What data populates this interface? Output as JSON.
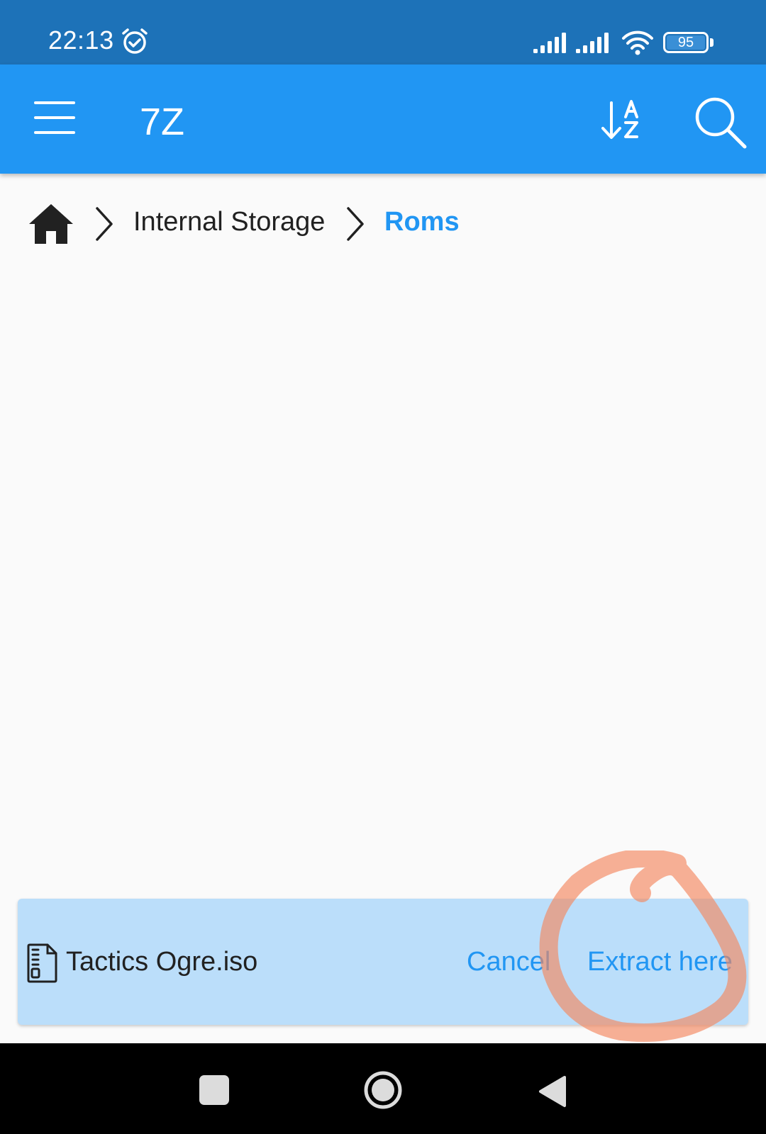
{
  "status_bar": {
    "time": "22:13",
    "battery": "95"
  },
  "app_bar": {
    "title": "7Z"
  },
  "breadcrumb": {
    "items": [
      "Internal Storage",
      "Roms"
    ]
  },
  "action_panel": {
    "file_name": "Tactics Ogre.iso",
    "cancel_label": "Cancel",
    "extract_label": "Extract here"
  },
  "colors": {
    "status_bar": "#1d72b8",
    "app_bar": "#2196f3",
    "accent": "#2196f3",
    "panel_bg": "#bbdefa",
    "annotation": "#f4875f"
  },
  "icons": {
    "status_alarm": "alarm-icon",
    "signal": "signal-icon",
    "wifi": "wifi-icon",
    "battery": "battery-icon",
    "menu": "menu-icon",
    "sort": "sort-az-icon",
    "search": "search-icon",
    "home": "home-icon",
    "chevron": "chevron-right-icon",
    "file": "zip-file-icon",
    "nav_recents": "square-icon",
    "nav_home": "circle-icon",
    "nav_back": "triangle-back-icon"
  }
}
